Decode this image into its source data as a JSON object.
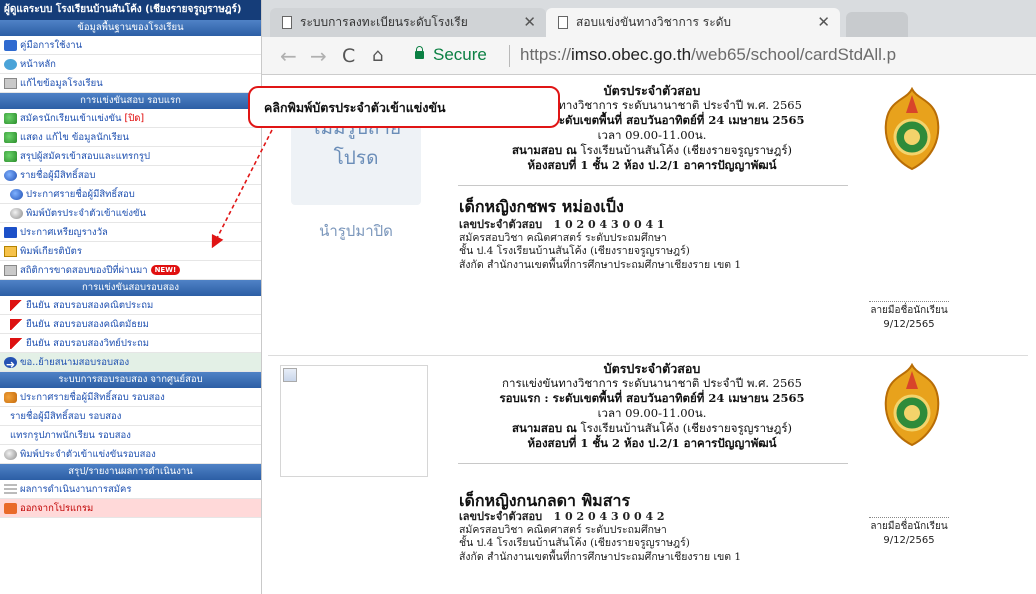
{
  "sidebar": {
    "header": "ผู้ดูแลระบบ โรงเรียนบ้านสันโค้ง (เชียงรายจรูญราษฎร์)",
    "sections": [
      {
        "title": "ข้อมูลพื้นฐานของโรงเรียน",
        "items": [
          {
            "icon": "book-icon",
            "label": "คู่มือการใช้งาน"
          },
          {
            "icon": "home-icon",
            "label": "หน้าหลัก"
          },
          {
            "icon": "edit-icon",
            "label": "แก้ไขข้อมูลโรงเรียน"
          }
        ]
      },
      {
        "title": "การแข่งขันสอบ รอบแรก",
        "items": [
          {
            "icon": "register-icon",
            "label": "สมัครนักเรียนเข้าแข่งขัน",
            "tag": "[ปิด]"
          },
          {
            "icon": "student-icon",
            "label": "แสดง แก้ไข ข้อมูลนักเรียน"
          },
          {
            "icon": "summary-icon",
            "label": "สรุปผู้สมัครเข้าสอบและแทรกรูป"
          },
          {
            "icon": "globe-icon",
            "label": "รายชื่อผู้มีสิทธิ์สอบ"
          },
          {
            "icon": "globe-icon",
            "label": "ประกาศรายชื่อผู้มีสิทธิ์สอบ",
            "indent": true
          },
          {
            "icon": "print-icon",
            "label": "พิมพ์บัตรประจำตัวเข้าแข่งขัน",
            "indent": true
          },
          {
            "icon": "document-icon",
            "label": "ประกาศเหรียญรางวัล"
          },
          {
            "icon": "certificate-icon",
            "label": "พิมพ์เกียรติบัตร"
          },
          {
            "icon": "stats-icon",
            "label": "สถิติการขาดสอบของปีที่ผ่านมา",
            "badge": "NEW!"
          }
        ]
      },
      {
        "title": "การแข่งขันสอบรอบสอง",
        "items": [
          {
            "icon": "flag-icon",
            "label": "ยืนยัน สอบรอบสองคณิตประถม",
            "indent": true
          },
          {
            "icon": "flag-icon",
            "label": "ยืนยัน สอบรอบสองคณิตมัธยม",
            "indent": true
          },
          {
            "icon": "flag-icon",
            "label": "ยืนยัน สอบรอบสองวิทย์ประถม",
            "indent": true
          },
          {
            "icon": "arrow-right-icon",
            "label": "ขอ..ย้ายสนามสอบรอบสอง",
            "highlight": true
          }
        ]
      },
      {
        "title": "ระบบการสอบรอบสอง จากศูนย์สอบ",
        "items": [
          {
            "icon": "people-icon",
            "label": "ประกาศรายชื่อผู้มีสิทธิ์สอบ รอบสอง"
          },
          {
            "icon": "",
            "label": "รายชื่อผู้มีสิทธิ์สอบ รอบสอง"
          },
          {
            "icon": "",
            "label": "แทรกรูปภาพนักเรียน รอบสอง"
          },
          {
            "icon": "print-icon",
            "label": "พิมพ์ประจำตัวเข้าแข่งขันรอบสอง"
          }
        ]
      },
      {
        "title": "สรุป/รายงานผลการดำเนินงาน",
        "items": [
          {
            "icon": "list-icon",
            "label": "ผลการดำเนินงานการสมัคร"
          },
          {
            "icon": "exit-icon",
            "label": "ออกจากโปรแกรม",
            "warn": true
          }
        ]
      }
    ]
  },
  "browser": {
    "tabs": [
      {
        "label": "ระบบการลงทะเบียนระดับโรงเรีย",
        "active": false
      },
      {
        "label": "สอบแข่งขันทางวิชาการ ระดับ",
        "active": true
      }
    ],
    "nav": {
      "back": "←",
      "forward": "→",
      "reload": "C",
      "home": "⌂"
    },
    "secure_label": "Secure",
    "url_prefix": "https://",
    "url_host": "imso.obec.go.th",
    "url_path": "/web65/school/cardStdAll.p"
  },
  "cards": [
    {
      "photo_line1": "ไม่มีรูปถ่าย",
      "photo_line2": "โปรด",
      "photo_caption": "นำรูปมาปิด",
      "title": "บัตรประจำตัวสอบ",
      "line_competition": "การแข่งขันทางวิชาการ ระดับนานาชาติ ประจำปี พ.ศ. 2565",
      "line_round": "รอบแรก : ระดับเขตพื้นที่ สอบวันอาทิตย์ที่ 24 เมษายน 2565",
      "line_time": "เวลา 09.00-11.00น.",
      "line_venue_label": "สนามสอบ ณ",
      "line_venue": "โรงเรียนบ้านสันโค้ง (เชียงรายจรูญราษฎร์)",
      "line_room": "ห้องสอบที่ 1 ชั้น 2 ห้อง ป.2/1 อาคารปัญญาพัฒน์",
      "student_name": "เด็กหญิงกชพร  หม่องเป็ง",
      "id_label": "เลขประจำตัวสอบ",
      "id_value": "1 0 2 0 4 3 0 0 4 1",
      "subject": "สมัครสอบวิชา คณิตศาสตร์ ระดับประถมศึกษา",
      "school": "ชั้น ป.4 โรงเรียนบ้านสันโค้ง (เชียงรายจรูญราษฎร์)",
      "area": "สังกัด สำนักงานเขตพื้นที่การศึกษาประถมศึกษาเชียงราย เขต 1",
      "sign_label": "ลายมือชื่อนักเรียน",
      "sign_date": "9/12/2565"
    },
    {
      "title": "บัตรประจำตัวสอบ",
      "line_competition": "การแข่งขันทางวิชาการ ระดับนานาชาติ ประจำปี พ.ศ. 2565",
      "line_round": "รอบแรก : ระดับเขตพื้นที่ สอบวันอาทิตย์ที่ 24 เมษายน 2565",
      "line_time": "เวลา 09.00-11.00น.",
      "line_venue_label": "สนามสอบ ณ",
      "line_venue": "โรงเรียนบ้านสันโค้ง (เชียงรายจรูญราษฎร์)",
      "line_room": "ห้องสอบที่ 1 ชั้น 2 ห้อง ป.2/1 อาคารปัญญาพัฒน์",
      "student_name": "เด็กหญิงกนกลดา  พิมสาร",
      "id_label": "เลขประจำตัวสอบ",
      "id_value": "1 0 2 0 4 3 0 0 4 2",
      "subject": "สมัครสอบวิชา คณิตศาสตร์ ระดับประถมศึกษา",
      "school": "ชั้น ป.4 โรงเรียนบ้านสันโค้ง (เชียงรายจรูญราษฎร์)",
      "area": "สังกัด สำนักงานเขตพื้นที่การศึกษาประถมศึกษาเชียงราย เขต 1",
      "sign_label": "ลายมือชื่อนักเรียน",
      "sign_date": "9/12/2565"
    }
  ],
  "annotation": {
    "callout_text": "คลิกพิมพ์บัตรประจำตัวเข้าแข่งขัน",
    "color": "#e01515"
  },
  "colors": {
    "sidebar_header": "#153d79",
    "sidebar_section": "#2c5ea5",
    "sidebar_link": "#1d4fb0",
    "secure_green": "#0b8043"
  }
}
